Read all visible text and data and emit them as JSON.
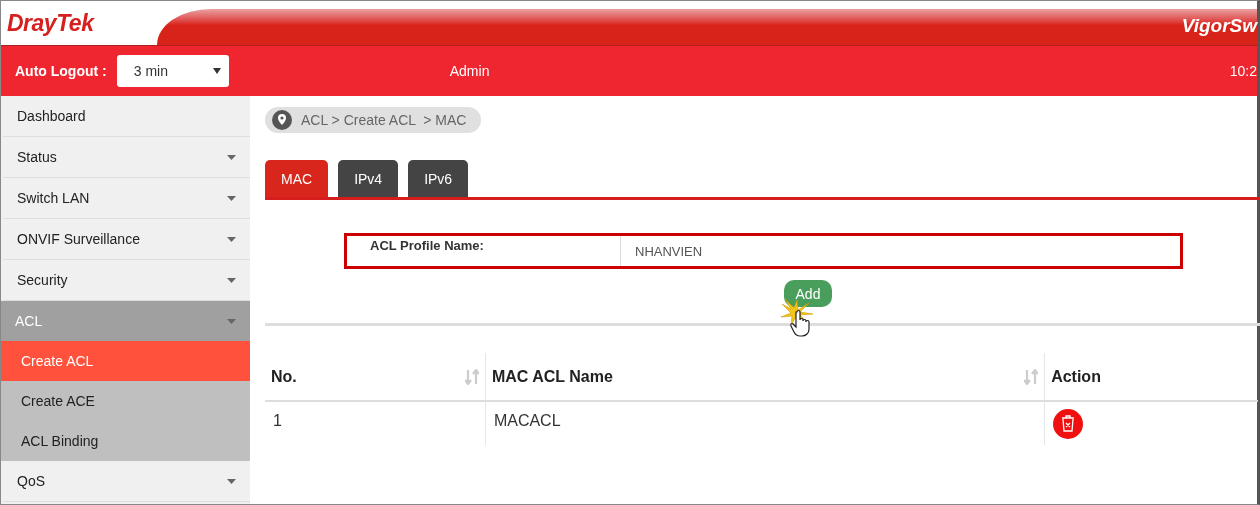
{
  "header": {
    "logo": "DrayTek",
    "product": "VigorSw"
  },
  "topbar": {
    "auto_logout_label": "Auto Logout :",
    "auto_logout_value": "3 min",
    "user": "Admin",
    "time": "10:2"
  },
  "sidebar": {
    "items": [
      {
        "label": "Dashboard",
        "kind": "link",
        "expanded": false,
        "selected": false
      },
      {
        "label": "Status",
        "kind": "menu",
        "expanded": false,
        "selected": false
      },
      {
        "label": "Switch LAN",
        "kind": "menu",
        "expanded": false,
        "selected": false
      },
      {
        "label": "ONVIF Surveillance",
        "kind": "menu",
        "expanded": false,
        "selected": false
      },
      {
        "label": "Security",
        "kind": "menu",
        "expanded": false,
        "selected": false
      },
      {
        "label": "ACL",
        "kind": "menu",
        "expanded": true,
        "selected": false,
        "children": [
          {
            "label": "Create ACL",
            "selected": true
          },
          {
            "label": "Create ACE",
            "selected": false
          },
          {
            "label": "ACL Binding",
            "selected": false
          }
        ]
      },
      {
        "label": "QoS",
        "kind": "menu",
        "expanded": false,
        "selected": false
      }
    ]
  },
  "breadcrumb": "ACL > Create ACL  > MAC",
  "tabs": [
    {
      "label": "MAC",
      "selected": true
    },
    {
      "label": "IPv4",
      "selected": false
    },
    {
      "label": "IPv6",
      "selected": false
    }
  ],
  "form": {
    "label": "ACL Profile Name:",
    "value": "NHANVIEN",
    "button": "Add"
  },
  "table": {
    "columns": [
      {
        "label": "No.",
        "sortable": true
      },
      {
        "label": "MAC ACL Name",
        "sortable": true
      },
      {
        "label": "Action",
        "sortable": false
      }
    ],
    "rows": [
      {
        "cells": [
          "1",
          "MACACL"
        ]
      }
    ]
  }
}
